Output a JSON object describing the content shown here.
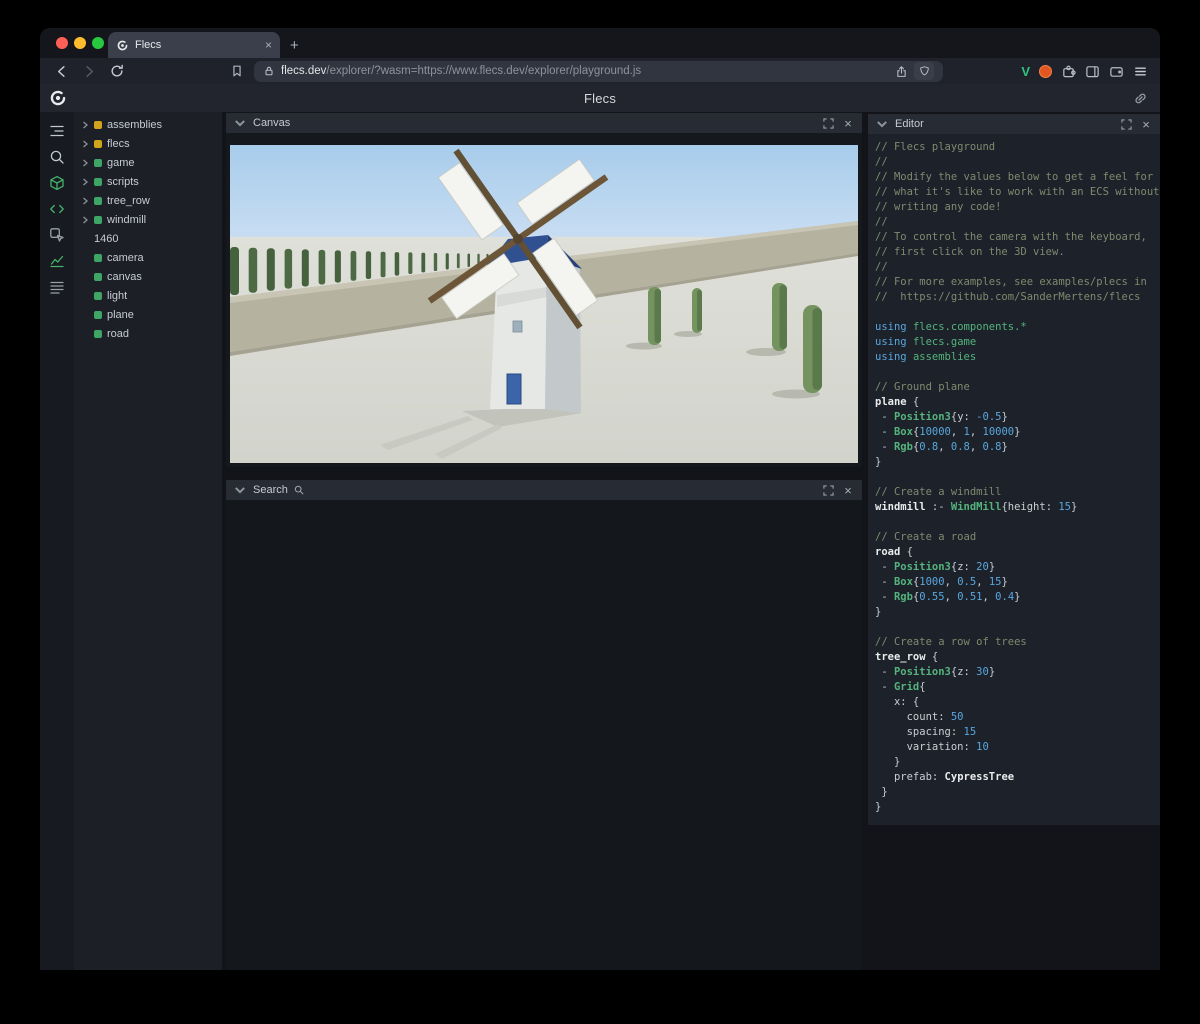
{
  "icons": {
    "close": "×",
    "plus": "+"
  },
  "browser": {
    "tab_title": "Flecs",
    "url_domain": "flecs.dev",
    "url_path": "/explorer/?wasm=https://www.flecs.dev/explorer/playground.js"
  },
  "app": {
    "title": "Flecs"
  },
  "sidebar_icons": [
    {
      "name": "outline-tree-icon",
      "color": "#c3c8cf"
    },
    {
      "name": "search-icon",
      "color": "#c3c8cf"
    },
    {
      "name": "entities-cube-icon",
      "color": "#45b169"
    },
    {
      "name": "code-icon",
      "color": "#45b169"
    },
    {
      "name": "inspect-icon",
      "color": "#9aa1a9"
    },
    {
      "name": "stats-chart-icon",
      "color": "#45b169"
    },
    {
      "name": "queries-list-icon",
      "color": "#9aa1a9"
    }
  ],
  "tree": {
    "items": [
      {
        "label": "assemblies",
        "chevron": true,
        "square": "#d0a51d"
      },
      {
        "label": "flecs",
        "chevron": true,
        "square": "#d0a51d"
      },
      {
        "label": "game",
        "chevron": true,
        "square": "#3fa564"
      },
      {
        "label": "scripts",
        "chevron": true,
        "square": "#3fa564"
      },
      {
        "label": "tree_row",
        "chevron": true,
        "square": "#3fa564"
      },
      {
        "label": "windmill",
        "chevron": true,
        "square": "#3fa564"
      },
      {
        "label": "1460",
        "chevron": false,
        "square": ""
      },
      {
        "label": "camera",
        "chevron": false,
        "square": "#3fa564"
      },
      {
        "label": "canvas",
        "chevron": false,
        "square": "#3fa564"
      },
      {
        "label": "light",
        "chevron": false,
        "square": "#3fa564"
      },
      {
        "label": "plane",
        "chevron": false,
        "square": "#3fa564"
      },
      {
        "label": "road",
        "chevron": false,
        "square": "#3fa564"
      }
    ]
  },
  "panels": {
    "canvas_title": "Canvas",
    "search_title": "Search",
    "editor_title": "Editor"
  },
  "editor": {
    "code_lines": [
      [
        [
          "cm",
          "// Flecs playground"
        ]
      ],
      [
        [
          "cm",
          "//"
        ]
      ],
      [
        [
          "cm",
          "// Modify the values below to get a feel for"
        ]
      ],
      [
        [
          "cm",
          "// what it's like to work with an ECS without"
        ]
      ],
      [
        [
          "cm",
          "// writing any code!"
        ]
      ],
      [
        [
          "cm",
          "//"
        ]
      ],
      [
        [
          "cm",
          "// To control the camera with the keyboard,"
        ]
      ],
      [
        [
          "cm",
          "// first click on the 3D view."
        ]
      ],
      [
        [
          "cm",
          "//"
        ]
      ],
      [
        [
          "cm",
          "// For more examples, see examples/plecs in"
        ]
      ],
      [
        [
          "cm",
          "//  https://github.com/SanderMertens/flecs"
        ]
      ],
      [],
      [
        [
          "kw",
          "using "
        ],
        [
          "mod",
          "flecs.components.*"
        ]
      ],
      [
        [
          "kw",
          "using "
        ],
        [
          "mod",
          "flecs.game"
        ]
      ],
      [
        [
          "kw",
          "using "
        ],
        [
          "mod",
          "assemblies"
        ]
      ],
      [],
      [
        [
          "cm",
          "// Ground plane"
        ]
      ],
      [
        [
          "ent",
          "plane"
        ],
        [
          "pl",
          " {"
        ]
      ],
      [
        [
          "pl",
          " - "
        ],
        [
          "ty",
          "Position3"
        ],
        [
          "pl",
          "{y: "
        ],
        [
          "num",
          "-0.5"
        ],
        [
          "pl",
          "}"
        ]
      ],
      [
        [
          "pl",
          " - "
        ],
        [
          "ty",
          "Box"
        ],
        [
          "pl",
          "{"
        ],
        [
          "num",
          "10000"
        ],
        [
          "pl",
          ", "
        ],
        [
          "num",
          "1"
        ],
        [
          "pl",
          ", "
        ],
        [
          "num",
          "10000"
        ],
        [
          "pl",
          "}"
        ]
      ],
      [
        [
          "pl",
          " - "
        ],
        [
          "ty",
          "Rgb"
        ],
        [
          "pl",
          "{"
        ],
        [
          "num",
          "0.8"
        ],
        [
          "pl",
          ", "
        ],
        [
          "num",
          "0.8"
        ],
        [
          "pl",
          ", "
        ],
        [
          "num",
          "0.8"
        ],
        [
          "pl",
          "}"
        ]
      ],
      [
        [
          "pl",
          "}"
        ]
      ],
      [],
      [
        [
          "cm",
          "// Create a windmill"
        ]
      ],
      [
        [
          "ent",
          "windmill"
        ],
        [
          "pl",
          " :- "
        ],
        [
          "ty",
          "WindMill"
        ],
        [
          "pl",
          "{height: "
        ],
        [
          "num",
          "15"
        ],
        [
          "pl",
          "}"
        ]
      ],
      [],
      [
        [
          "cm",
          "// Create a road"
        ]
      ],
      [
        [
          "ent",
          "road"
        ],
        [
          "pl",
          " {"
        ]
      ],
      [
        [
          "pl",
          " - "
        ],
        [
          "ty",
          "Position3"
        ],
        [
          "pl",
          "{z: "
        ],
        [
          "num",
          "20"
        ],
        [
          "pl",
          "}"
        ]
      ],
      [
        [
          "pl",
          " - "
        ],
        [
          "ty",
          "Box"
        ],
        [
          "pl",
          "{"
        ],
        [
          "num",
          "1000"
        ],
        [
          "pl",
          ", "
        ],
        [
          "num",
          "0.5"
        ],
        [
          "pl",
          ", "
        ],
        [
          "num",
          "15"
        ],
        [
          "pl",
          "}"
        ]
      ],
      [
        [
          "pl",
          " - "
        ],
        [
          "ty",
          "Rgb"
        ],
        [
          "pl",
          "{"
        ],
        [
          "num",
          "0.55"
        ],
        [
          "pl",
          ", "
        ],
        [
          "num",
          "0.51"
        ],
        [
          "pl",
          ", "
        ],
        [
          "num",
          "0.4"
        ],
        [
          "pl",
          "}"
        ]
      ],
      [
        [
          "pl",
          "}"
        ]
      ],
      [],
      [
        [
          "cm",
          "// Create a row of trees"
        ]
      ],
      [
        [
          "ent",
          "tree_row"
        ],
        [
          "pl",
          " {"
        ]
      ],
      [
        [
          "pl",
          " - "
        ],
        [
          "ty",
          "Position3"
        ],
        [
          "pl",
          "{z: "
        ],
        [
          "num",
          "30"
        ],
        [
          "pl",
          "}"
        ]
      ],
      [
        [
          "pl",
          " - "
        ],
        [
          "ty",
          "Grid"
        ],
        [
          "pl",
          "{"
        ]
      ],
      [
        [
          "pl",
          "   x: {"
        ]
      ],
      [
        [
          "pl",
          "     count: "
        ],
        [
          "num",
          "50"
        ]
      ],
      [
        [
          "pl",
          "     spacing: "
        ],
        [
          "num",
          "15"
        ]
      ],
      [
        [
          "pl",
          "     variation: "
        ],
        [
          "num",
          "10"
        ]
      ],
      [
        [
          "pl",
          "   }"
        ]
      ],
      [
        [
          "pl",
          "   prefab: "
        ],
        [
          "ent",
          "CypressTree"
        ]
      ],
      [
        [
          "pl",
          " }"
        ]
      ],
      [
        [
          "pl",
          "}"
        ]
      ]
    ]
  }
}
